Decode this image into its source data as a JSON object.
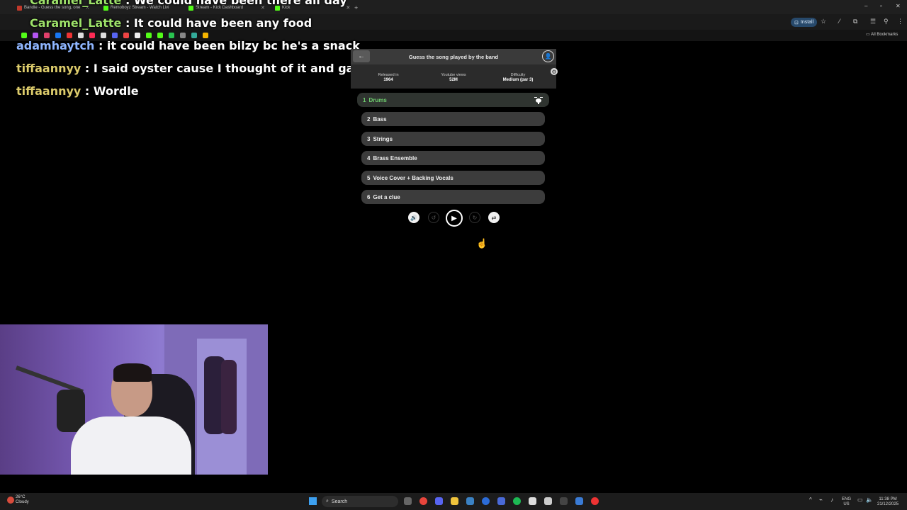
{
  "browser": {
    "tabs": [
      {
        "title": "Bandle - Guess the song, one"
      },
      {
        "title": "Remoboyz Stream - Watch Livi"
      },
      {
        "title": "Stream - Kick Dashboard"
      },
      {
        "title": "Kick"
      }
    ],
    "new_tab": "+",
    "install_label": "Install",
    "all_bookmarks": "All Bookmarks"
  },
  "chat": {
    "lines": [
      {
        "user": "Caramel_Latte",
        "message": " : We could have been there all day"
      },
      {
        "user": "Caramel_Latte",
        "message": " : It could have been any food"
      },
      {
        "user": "adamhaytch",
        "message": " : it could have been bilzy bc he's a snack"
      },
      {
        "user": "tiffaannyy",
        "message": " : I said oyster cause I thought of it and gagged"
      },
      {
        "user": "tiffaannyy",
        "message": " : Wordle"
      }
    ]
  },
  "game": {
    "title": "Guess the song played by the band",
    "back_icon": "←",
    "stats": [
      {
        "label": "Released in",
        "value": "1964"
      },
      {
        "label": "Youtube views",
        "value": "52M"
      },
      {
        "label": "Difficulty",
        "value": "Medium (par 3)"
      }
    ],
    "tracks": [
      {
        "num": "1",
        "label": "Drums"
      },
      {
        "num": "2",
        "label": "Bass"
      },
      {
        "num": "3",
        "label": "Strings"
      },
      {
        "num": "4",
        "label": "Brass Ensemble"
      },
      {
        "num": "5",
        "label": "Voice Cover + Backing Vocals"
      },
      {
        "num": "6",
        "label": "Get a clue"
      }
    ],
    "active_track_color": "#6fcf6f"
  },
  "taskbar": {
    "weather_temp": "26°C",
    "weather_desc": "Cloudy",
    "search_label": "Search",
    "lang_top": "ENG",
    "lang_bottom": "US",
    "time": "11:38 PM",
    "date": "21/12/2025"
  }
}
